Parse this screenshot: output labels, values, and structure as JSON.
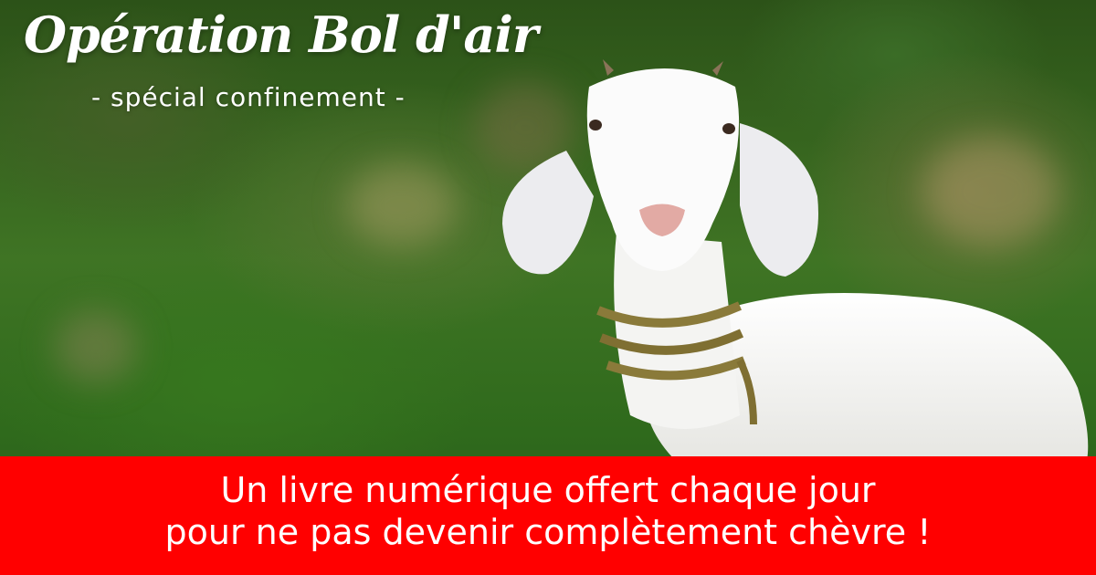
{
  "hero": {
    "title": "Opération Bol d'air",
    "subtitle": "- spécial confinement -",
    "image_subject": "goat-photo"
  },
  "footer": {
    "line1": "Un livre numérique offert chaque jour",
    "line2": "pour ne pas devenir complètement chèvre !",
    "background_color": "#ff0000"
  }
}
